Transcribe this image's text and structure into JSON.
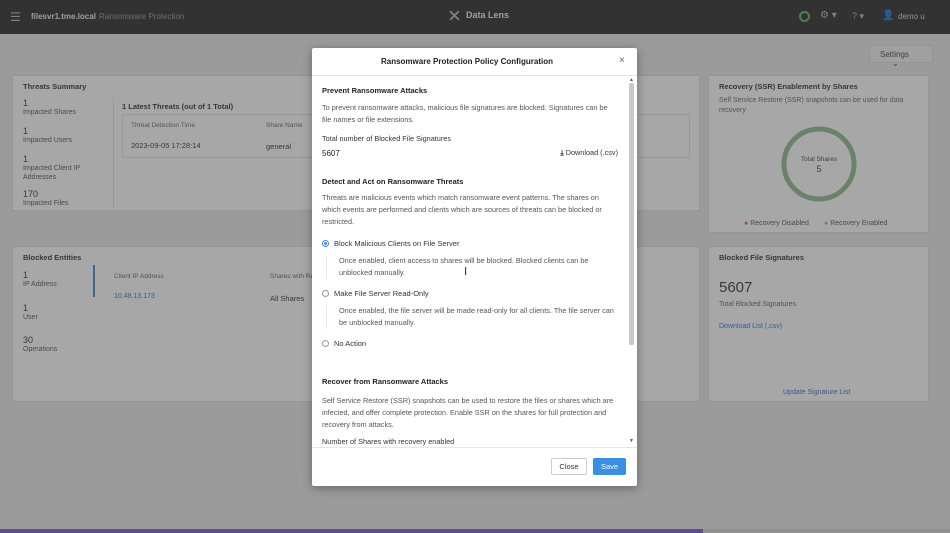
{
  "topbar": {
    "host": "filesvr1.tme.local",
    "breadcrumb_sep": "›",
    "breadcrumb": "Ransomware Protection",
    "brand": "Data Lens",
    "user": "demo u",
    "help": "? ▾",
    "gear": "⚙ ▾"
  },
  "settings_label": "Settings",
  "threats_summary": {
    "title": "Threats Summary",
    "stats": [
      {
        "value": "1",
        "label": "Impacted Shares"
      },
      {
        "value": "1",
        "label": "Impacted Users"
      },
      {
        "value": "1",
        "label": "Impacted Client IP Addresses"
      },
      {
        "value": "170",
        "label": "Impacted Files"
      }
    ],
    "latest_title": "1 Latest Threats (out of 1 Total)",
    "columns": [
      "Threat Detection Time",
      "Share Name"
    ],
    "row": {
      "time": "2023-09-05 17:28:14",
      "share": "general"
    }
  },
  "blocked_entities": {
    "title": "Blocked Entities",
    "stats": [
      {
        "value": "1",
        "label": "IP Address"
      },
      {
        "value": "1",
        "label": "User"
      },
      {
        "value": "30",
        "label": "Operations"
      }
    ],
    "columns": [
      "Client IP Address",
      "Shares with Re"
    ],
    "row": {
      "ip": "10.48.13.173",
      "shares": "All Shares"
    }
  },
  "recovery": {
    "title": "Recovery (SSR) Enablement by Shares",
    "desc": "Self Service Restore (SSR) snapshots can be used for data recovery",
    "donut_label": "Total Shares",
    "donut_value": "5",
    "legend_disabled": "Recovery Disabled",
    "legend_enabled": "Recovery Enabled",
    "colors": {
      "disabled": "#d9534f",
      "enabled": "#8fbc8f"
    }
  },
  "blocked_signatures": {
    "title": "Blocked File Signatures",
    "value": "5607",
    "label": "Total Blocked Signatures",
    "download": "Download List (.csv)",
    "update": "Update Signature List"
  },
  "modal": {
    "title": "Ransomware Protection Policy Configuration",
    "close": "×",
    "sec1_title": "Prevent Ransomware Attacks",
    "sec1_desc": "To prevent ransomware attacks, malicious file signatures are blocked. Signatures can be file names or file extensions.",
    "total_label": "Total number of Blocked File Signatures",
    "total_value": "5607",
    "download": "Download (.csv)",
    "sec2_title": "Detect and Act on Ransomware Threats",
    "sec2_desc": "Threats are malicious events which match ransomware event patterns. The shares on which events are performed and clients which are sources of threats can be blocked or restricted.",
    "opt1": "Block Malicious Clients on File Server",
    "opt1_desc": "Once enabled, client access to shares will be blocked. Blocked clients can be unblocked manually.",
    "opt2": "Make File Server Read-Only",
    "opt2_desc": "Once enabled, the file server will be made read-only for all clients. The file server can be unblocked manually.",
    "opt3": "No Action",
    "sec3_title": "Recover from Ransomware Attacks",
    "sec3_desc": "Self Service Restore (SSR) snapshots can be used to restore the files or shares which are infected, and offer complete protection. Enable SSR on the shares for full protection and recovery from attacks.",
    "sec3_cut": "Number of Shares with recovery enabled",
    "btn_close": "Close",
    "btn_save": "Save",
    "accent": "#3b8ee0"
  },
  "progress_fraction": 0.74
}
